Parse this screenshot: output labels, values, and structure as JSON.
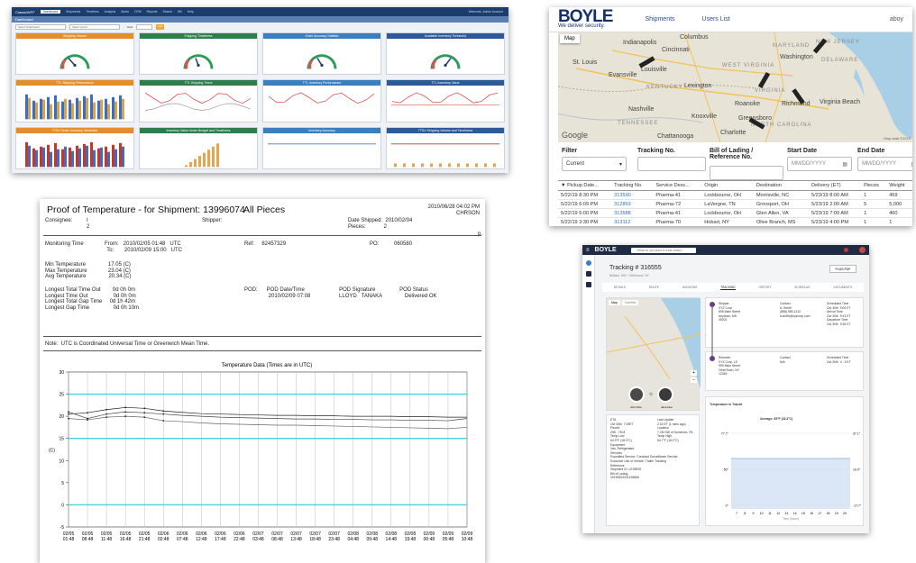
{
  "dashboard": {
    "logo": "ClassicWFF",
    "tabs": [
      "Dashboard",
      "Shipments",
      "Timelines",
      "Analysis",
      "Alerts",
      "CRM",
      "Reports",
      "Search",
      "Bill",
      "Help"
    ],
    "subtitle": "Dashboard",
    "user": "Welcome, Admin Account",
    "filter1": "Select Dashboard",
    "filter2": "Select Action",
    "filter_label": "Date",
    "go": "GO",
    "panel_titles": [
      "Shipping Volume",
      "Shipping Timeliness",
      "Order Accuracy Statistic",
      "Available Inventory Threshold",
      "TTL Shipping Performance",
      "TTL Shipping Trend",
      "TTL Inventory Performance",
      "TTL Inventory Value",
      "TTSV Order Accuracy Variances",
      "Inventory Value Under Budget and Timeliness",
      "Inventory Accuracy",
      "TTSV Shipping Volume and Timeliness"
    ],
    "panel_colors": [
      "#e48d2a",
      "#2e7d4b",
      "#3b7fc0",
      "#2c5a96",
      "#e48d2a",
      "#2e7d4b",
      "#3b7fc0",
      "#2c5a96",
      "#e48d2a",
      "#2e7d4b",
      "#3b7fc0",
      "#2c5a96"
    ]
  },
  "mapapp": {
    "logo": "BOYLE",
    "tagline": "We deliver security.",
    "nav": [
      "Shipments",
      "Users List"
    ],
    "user": "aboy",
    "map_labels": [
      "Indianapolis",
      "Cincinnati",
      "Columbus",
      "St. Louis",
      "Louisville",
      "KENTUCKY",
      "Evansville",
      "Nashville",
      "TENNESSEE",
      "WEST VIRGINIA",
      "VIRGINIA",
      "Richmond",
      "Washington",
      "MARYLAND",
      "NEW JERSEY",
      "DELAWARE",
      "Charlotte",
      "NORTH CAROLINA",
      "Greensboro",
      "Virginia Beach",
      "Chattanooga",
      "Knoxville",
      "Roanoke",
      "Lexington"
    ],
    "map_mode": "Map",
    "google": "Google",
    "map_data": "Map data ©2019",
    "filter_labels": [
      "Filter",
      "Tracking No.",
      "Bill of Lading / Reference No.",
      "Start Date",
      "End Date"
    ],
    "filter_value": "Current",
    "date_placeholder": "MM/DD/YYYY",
    "columns": [
      "▼ Pickup Date...",
      "Tracking No.",
      "Service Desc...",
      "Origin",
      "Destination",
      "Delivery (ET)",
      "Pieces",
      "Weight"
    ],
    "rows": [
      [
        "5/22/19 8:30 PM",
        "313590",
        "Pharma-41",
        "Lockbourne, OH",
        "Morrisville, NC",
        "5/23/19 8:00 AM",
        "1",
        "459"
      ],
      [
        "5/22/19 6:09 PM",
        "312863",
        "Pharma-72",
        "LaVergne, TN",
        "Grovsport, OH",
        "5/23/19 2:00 AM",
        "5",
        "5,000"
      ],
      [
        "5/22/19 5:00 PM",
        "313588",
        "Pharma-41",
        "Lockbourne, OH",
        "Glen Allen, VA",
        "5/23/19 7:00 AM",
        "1",
        "460"
      ],
      [
        "5/22/19 3:30 PM",
        "313112",
        "Pharma-70",
        "Hobart, NY",
        "Olive Branch, MS",
        "5/23/19 4:00 PM",
        "1",
        "1"
      ]
    ]
  },
  "report": {
    "title": "Proof of Temperature - for Shipment: 13996074",
    "pieces_title": "All Pieces",
    "datetime": "2010/06/28 04:02 PM",
    "user": "CHRSON",
    "consignee_label": "Consignee:",
    "consignee_value": "I\n2",
    "shipper_label": "Shipper:",
    "date_shipped": "Date Shipped:  2010/02/04\nPieces:            2",
    "monitoring": "Monitoring Time              From:   2010/02/05 01:48   UTC\n                                         To:       2010/02/09 15:00   UTC",
    "ref": "Ref:     82457329",
    "po": "PO:          060580",
    "temps": "Min Temperature               17.05 (C)\nMax Temperature              23.04 (C)\nAvg Temperature               20.34 (C)",
    "timeout": "Longest Total Time Out        0d 0h 0m\nLongest Time Out                 0d 0h 0m\nLongest Total Gap Time     0d 1h 42m\nLongest Gap Time                0d 0h 10m",
    "pod": "POD:      POD Date/Time                       POD Signature                POD Status\n                2010/02/09 07:08                   LLOYD   TANAKA               Delivered OK",
    "note": "Note:  UTC is Coordinated Universal Time or Greenwich Mean Time.",
    "chart_title": "Temperature Data  (Times are in UTC)",
    "y_unit": "(C)",
    "page_mark": "p."
  },
  "chart_data": {
    "type": "line",
    "title": "Temperature Data  (Times are in UTC)",
    "ylabel": "(C)",
    "ylim": [
      -5,
      30
    ],
    "yticks": [
      -5,
      0,
      5,
      10,
      15,
      20,
      25,
      30
    ],
    "reference_lines": [
      0,
      15,
      25
    ],
    "x": [
      "02/05 01:48",
      "02/05 08:48",
      "02/05 11:48",
      "02/05 16:48",
      "02/05 21:48",
      "02/06 02:48",
      "02/06 07:48",
      "02/06 12:48",
      "02/06 17:48",
      "02/06 22:48",
      "02/07 03:48",
      "02/07 08:48",
      "02/07 13:48",
      "02/07 18:48",
      "02/07 23:48",
      "02/08 04:48",
      "02/08 09:48",
      "02/08 14:48",
      "02/08 19:48",
      "02/09 00:48",
      "02/09 05:48",
      "02/09 10:48"
    ],
    "series": [
      {
        "values": [
          20.5,
          20.8,
          21.5,
          22,
          21.8,
          21.2,
          20.9,
          20.6,
          20.5,
          20.4,
          20.3,
          20.2,
          20.2,
          20.1,
          20.1,
          20,
          20,
          20,
          19.9,
          19.9,
          19.8,
          19.8
        ]
      },
      {
        "values": [
          21,
          19.5,
          20.5,
          21,
          20.8,
          20.5,
          20.2,
          20,
          19.8,
          19.7,
          19.6,
          19.5,
          19.4,
          19.4,
          19.3,
          19.3,
          19.2,
          19.2,
          19.1,
          19.1,
          19,
          19.5
        ]
      },
      {
        "values": [
          19.5,
          19.2,
          19.8,
          20,
          19.8,
          19,
          18.8,
          18.5,
          18.3,
          18.2,
          18.1,
          18,
          18,
          17.9,
          17.8,
          17.7,
          17.6,
          17.5,
          17.4,
          17.3,
          17.2,
          17.5
        ]
      }
    ]
  },
  "tracking": {
    "logo": "BOYLE",
    "search_ph": "What do you want to track today?",
    "number": "Tracking # 316555",
    "sub": "Brilliant, MS  >  Whitmond, NY",
    "pdf": "PLUS PDF",
    "tabs": [
      "DETAILS",
      "ROUTE",
      "INVOICING",
      "TRACKING",
      "HISTORY",
      "SCHEDULE",
      "DOCUMENTS"
    ],
    "map_tabs": [
      "Map",
      "Satellite"
    ],
    "driver1": "John Doe",
    "driver2": "Jane Doe",
    "shipper": "Shipper\nXYZ Corp.\n808 Main Street\nAnytown, MS\n39202",
    "shipper_contact": "Contact\nA. Smith\n(888) 555-1212\na.smith@xyzcorp.com",
    "shipper_times": "Scheduled Time\nOct 30th  9:00 ET\nArrival Time\nOct 30th  9:13 ET\nDeparture Time\nOct 30th  9:35 ET",
    "consignee": "Receiver\nXYZ Corp. LS\n999 Main Street\nOtherTown, NY\n12345",
    "consignee_contact": "Contact\nN/A",
    "consignee_times": "Scheduled Time\nOct 30th  4 - 5 ET",
    "temps_title": "Temperature in Transit",
    "avg": "Average: 65°F (18.3°C)",
    "details_left": "ETA\nOct 30th  7:29ET\nPieces\n298 - 7303\nTemp Low\n64.9°F (18.3°C)\nEquipment\nVan, Refrigerated\nServices\nExpedited Service, Constant Surveillance Service,\nExclusive Use of Vehicle, Trailer Tracking\nReference\nShipment ID: LE05878\nBill of Lading\n20190502001128866",
    "details_right": "Last Update\n2:02 ET (1 mins ago)\nLocation\n7.2M SW of Somerton, PA\nTemp High\n64.7°F (18.2°C)",
    "y_ticks": [
      "77.7°",
      "50°",
      "0°"
    ],
    "y_right": [
      "37.1°",
      "10.0°",
      "-17.7°"
    ],
    "x_ticks": [
      "7",
      "8",
      "9",
      "10",
      "11",
      "12",
      "13",
      "14",
      "15",
      "16",
      "17",
      "18",
      "19",
      "20"
    ],
    "x_label": "Time (hours)"
  }
}
